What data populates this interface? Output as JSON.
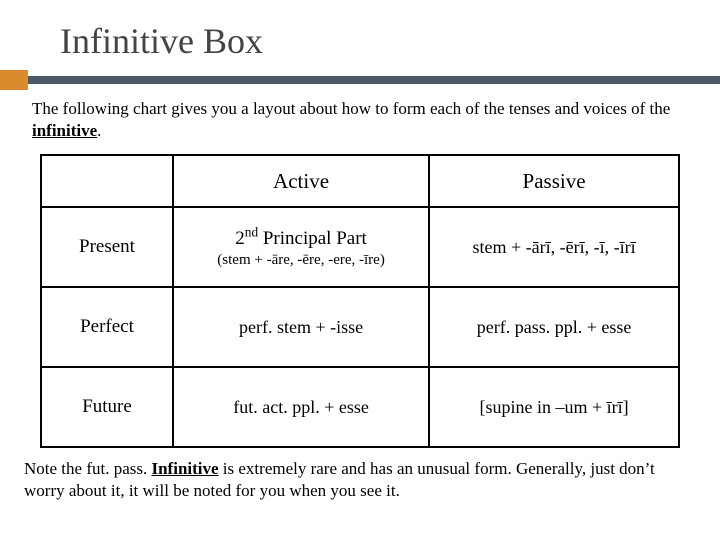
{
  "title": "Infinitive Box",
  "intro_a": "The following chart gives you a layout about how to form each of the tenses and voices of the ",
  "intro_b": "infinitive",
  "intro_c": ".",
  "headers": {
    "c1": "",
    "c2": "Active",
    "c3": "Passive"
  },
  "rows": {
    "present": {
      "label": "Present",
      "active_main": "2ⁿᵈ Principal Part",
      "active_sub": "(stem + -āre, -ēre, -ere, -īre)",
      "passive": "stem + -ārī, -ērī, -ī, -īrī"
    },
    "perfect": {
      "label": "Perfect",
      "active": "perf. stem + -isse",
      "passive": "perf. pass. ppl. + esse"
    },
    "future": {
      "label": "Future",
      "active": "fut. act. ppl. + esse",
      "passive": "[supine in –um + īrī]"
    }
  },
  "note_a": "Note the fut. pass. ",
  "note_b": "Infinitive",
  "note_c": " is extremely rare and has an unusual form. Generally, just don’t worry about it, it will be noted for you when you see it.",
  "chart_data": {
    "type": "table",
    "title": "Infinitive Box",
    "columns": [
      "",
      "Active",
      "Passive"
    ],
    "rows": [
      [
        "Present",
        "2nd Principal Part (stem + -āre, -ēre, -ere, -īre)",
        "stem + -ārī, -ērī, -ī, -īrī"
      ],
      [
        "Perfect",
        "perf. stem + -isse",
        "perf. pass. ppl. + esse"
      ],
      [
        "Future",
        "fut. act. ppl. + esse",
        "[supine in –um + īrī]"
      ]
    ]
  }
}
